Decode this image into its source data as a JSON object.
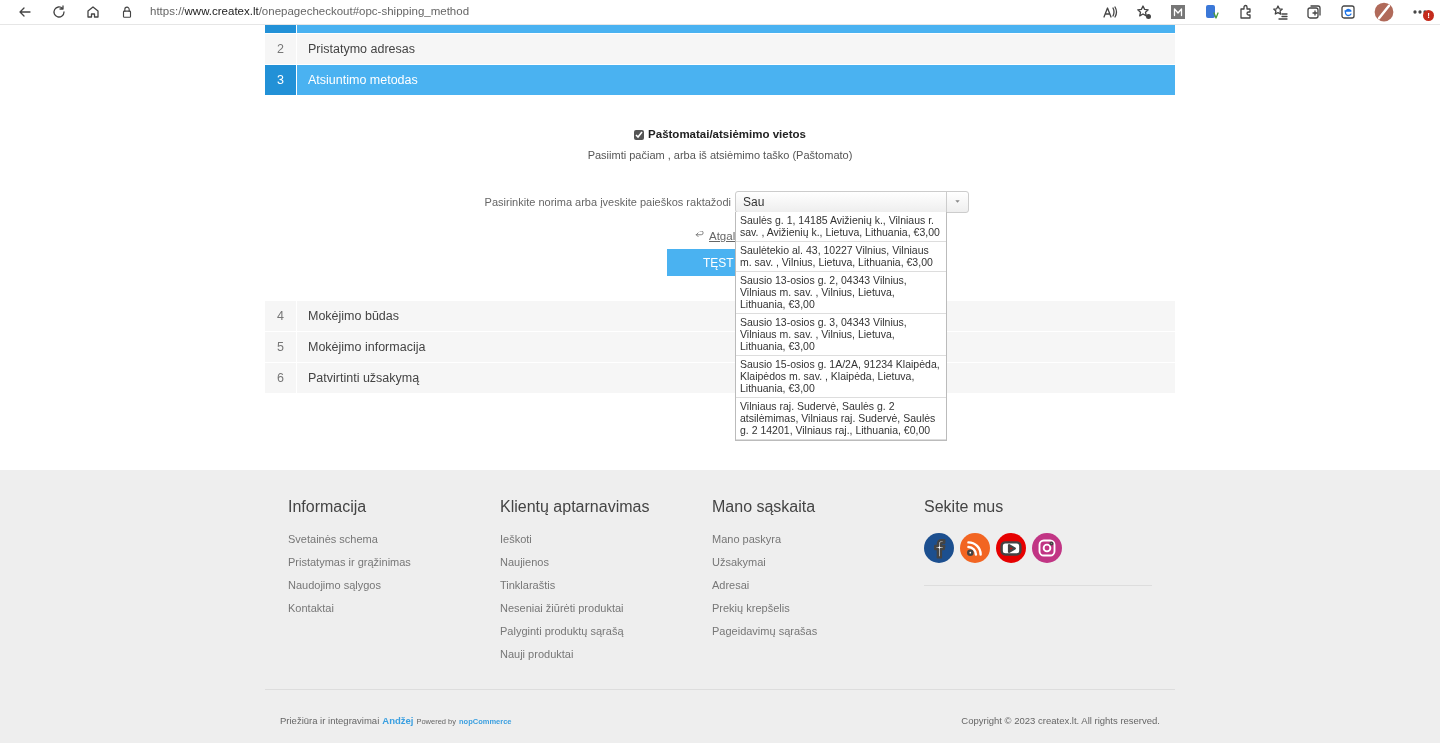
{
  "browser": {
    "url_prefix": "https://",
    "url_domain": "www.createx.lt",
    "url_path": "/onepagecheckout#opc-shipping_method",
    "notification_badge": "!"
  },
  "steps": [
    {
      "partial": true,
      "selected": true
    },
    {
      "number": "2",
      "title": "Pristatymo adresas",
      "selected": false
    },
    {
      "number": "3",
      "title": "Atsiuntimo metodas",
      "selected": true
    },
    {
      "number": "4",
      "title": "Mokėjimo būdas",
      "selected": false
    },
    {
      "number": "5",
      "title": "Mokėjimo informacija",
      "selected": false
    },
    {
      "number": "6",
      "title": "Patvirtinti užsakymą",
      "selected": false
    }
  ],
  "shipping": {
    "option_label": "Paštomatai/atsiėmimo vietos",
    "checked": true,
    "description": "Pasiimti pačiam , arba iš atsiėmimo taško (Paštomato)",
    "select_label": "Pasirinkite norima arba įveskite paieškos raktažodi",
    "select_value": "Sau",
    "back_link": "Atgal",
    "continue_button": "TĘST",
    "options": [
      "Saulės g. 1, 14185 Avižienių k., Vilniaus r. sav. , Avižienių k., Lietuva, Lithuania, €3,00",
      "Saulėtekio al. 43, 10227 Vilnius, Vilniaus m. sav. , Vilnius, Lietuva, Lithuania, €3,00",
      "Sausio 13-osios g. 2, 04343 Vilnius, Vilniaus m. sav. , Vilnius, Lietuva, Lithuania, €3,00",
      "Sausio 13-osios g. 3, 04343 Vilnius, Vilniaus m. sav. , Vilnius, Lietuva, Lithuania, €3,00",
      "Sausio 15-osios g. 1A/2A, 91234 Klaipėda, Klaipėdos m. sav. , Klaipėda, Lietuva, Lithuania, €3,00",
      "Vilniaus raj. Sudervė, Saulės g. 2 atsilėmimas, Vilniaus raj. Sudervė, Saulės g. 2 14201, Vilniaus raj., Lithuania, €0,00"
    ]
  },
  "footer": {
    "columns": [
      {
        "title": "Informacija",
        "links": [
          "Svetainės schema",
          "Pristatymas ir grąžinimas",
          "Naudojimo sąlygos",
          "Kontaktai"
        ]
      },
      {
        "title": "Klientų aptarnavimas",
        "links": [
          "Ieškoti",
          "Naujienos",
          "Tinklaraštis",
          "Neseniai žiūrėti produktai",
          "Palyginti produktų sąrašą",
          "Nauji produktai"
        ]
      },
      {
        "title": "Mano sąskaita",
        "links": [
          "Mano paskyra",
          "Užsakymai",
          "Adresai",
          "Prekių krepšelis",
          "Pageidavimų sąrašas"
        ]
      }
    ],
    "social": {
      "title": "Sekite mus",
      "icons": [
        {
          "kind": "facebook",
          "color": "#1c4f8f"
        },
        {
          "kind": "rss",
          "color": "#f26522"
        },
        {
          "kind": "youtube",
          "color": "#e60000"
        },
        {
          "kind": "instagram",
          "color": "#c13584"
        }
      ]
    },
    "maintenance_text": "Priežiūra ir integravimai",
    "maintenance_link": "Andžej",
    "powered_text": "Powered by",
    "powered_link": "nopCommerce",
    "copyright": "Copyright © 2023 createx.lt. All rights reserved."
  }
}
